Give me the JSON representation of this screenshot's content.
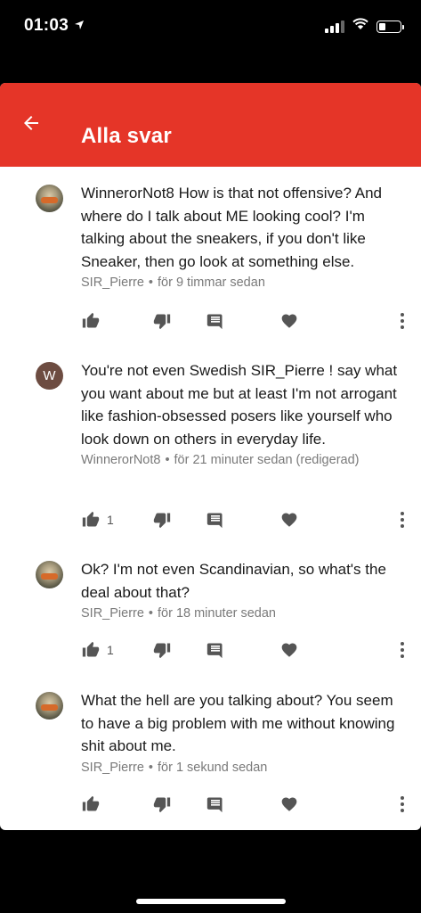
{
  "status": {
    "time": "01:03",
    "location_icon": "location-arrow-icon",
    "signal_icon": "signal-icon",
    "wifi_icon": "wifi-icon",
    "battery_icon": "battery-icon",
    "battery_level": 0.3
  },
  "header": {
    "back_icon": "arrow-left-icon",
    "title": "Alla svar",
    "color": "#e53528"
  },
  "comments": [
    {
      "avatar": "photo",
      "text": "WinnerorNot8 How is that not offensive? And where do I talk about ME looking cool? I'm talking about the sneakers, if you don't like Sneaker, then go look at something else.",
      "author": "SIR_Pierre",
      "separator": "•",
      "time": "för 9 timmar sedan",
      "likes": ""
    },
    {
      "avatar": "letter",
      "avatar_letter": "W",
      "avatar_color": "#6d4c41",
      "text": "You're not even Swedish SIR_Pierre ! say what you want about me but at least I'm not arrogant like fashion-obsessed posers like yourself who look down on others  in everyday life.",
      "author": "WinnerorNot8",
      "separator": "•",
      "time": "för 21 minuter sedan (redigerad)",
      "likes": "1"
    },
    {
      "avatar": "photo",
      "text": "Ok? I'm not even Scandinavian, so what's the deal about that?",
      "author": "SIR_Pierre",
      "separator": "•",
      "time": "för 18 minuter sedan",
      "likes": "1"
    },
    {
      "avatar": "photo",
      "text": "What the hell are you talking about? You seem to have a big problem with me without knowing shit about me.",
      "author": "SIR_Pierre",
      "separator": "•",
      "time": "för 1 sekund sedan",
      "likes": ""
    }
  ],
  "action_icons": [
    "thumbs-up-icon",
    "thumbs-down-icon",
    "reply-comment-icon",
    "heart-icon",
    "more-vert-icon"
  ]
}
